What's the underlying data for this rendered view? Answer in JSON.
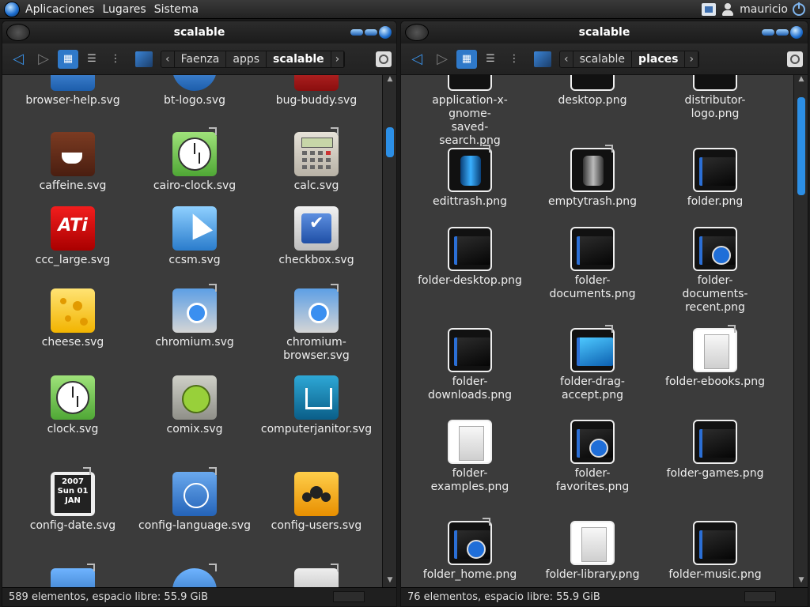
{
  "topbar": {
    "menus": [
      "Aplicaciones",
      "Lugares",
      "Sistema"
    ],
    "user": "mauricio"
  },
  "left": {
    "title": "scalable",
    "breadcrumbs": [
      "Faenza",
      "apps",
      "scalable"
    ],
    "status": "589 elementos, espacio libre: 55.9 GiB",
    "items": [
      {
        "label": "browser-help.svg",
        "icon": "browser-help-icon"
      },
      {
        "label": "bt-logo.svg",
        "icon": "bluetooth-icon"
      },
      {
        "label": "bug-buddy.svg",
        "icon": "bug-icon"
      },
      {
        "label": "caffeine.svg",
        "icon": "coffee-icon"
      },
      {
        "label": "cairo-clock.svg",
        "icon": "clock-icon"
      },
      {
        "label": "calc.svg",
        "icon": "calculator-icon"
      },
      {
        "label": "ccc_large.svg",
        "icon": "ati-icon"
      },
      {
        "label": "ccsm.svg",
        "icon": "cursor-icon"
      },
      {
        "label": "checkbox.svg",
        "icon": "checkbox-icon"
      },
      {
        "label": "cheese.svg",
        "icon": "cheese-icon"
      },
      {
        "label": "chromium.svg",
        "icon": "chromium-icon"
      },
      {
        "label": "chromium-browser.svg",
        "icon": "chromium-icon"
      },
      {
        "label": "clock.svg",
        "icon": "clock-icon"
      },
      {
        "label": "comix.svg",
        "icon": "comix-icon"
      },
      {
        "label": "computerjanitor.svg",
        "icon": "janitor-icon"
      },
      {
        "label": "config-date.svg",
        "icon": "calendar-icon"
      },
      {
        "label": "config-language.svg",
        "icon": "globe-icon"
      },
      {
        "label": "config-users.svg",
        "icon": "users-icon"
      }
    ],
    "calendar": {
      "year": "2007",
      "day": "Sun",
      "date": "01",
      "month": "JAN"
    },
    "ati_text": "ATi"
  },
  "right": {
    "title": "scalable",
    "breadcrumbs": [
      "scalable",
      "places"
    ],
    "status": "76 elementos, espacio libre: 55.9 GiB",
    "items": [
      {
        "label": "application-x-gnome-saved-search.png",
        "icon": "saved-search-icon"
      },
      {
        "label": "desktop.png",
        "icon": "desktop-icon"
      },
      {
        "label": "distributor-logo.png",
        "icon": "distributor-logo-icon"
      },
      {
        "label": "edittrash.png",
        "icon": "trash-full-icon"
      },
      {
        "label": "emptytrash.png",
        "icon": "trash-empty-icon"
      },
      {
        "label": "folder.png",
        "icon": "folder-icon"
      },
      {
        "label": "folder-desktop.png",
        "icon": "folder-desktop-icon"
      },
      {
        "label": "folder-documents.png",
        "icon": "folder-documents-icon"
      },
      {
        "label": "folder-documents-recent.png",
        "icon": "folder-recent-icon"
      },
      {
        "label": "folder-downloads.png",
        "icon": "folder-downloads-icon"
      },
      {
        "label": "folder-drag-accept.png",
        "icon": "folder-drag-icon"
      },
      {
        "label": "folder-ebooks.png",
        "icon": "folder-ebooks-icon"
      },
      {
        "label": "folder-examples.png",
        "icon": "folder-examples-icon"
      },
      {
        "label": "folder-favorites.png",
        "icon": "folder-favorites-icon"
      },
      {
        "label": "folder-games.png",
        "icon": "folder-games-icon"
      },
      {
        "label": "folder_home.png",
        "icon": "folder-home-icon"
      },
      {
        "label": "folder-library.png",
        "icon": "folder-library-icon"
      },
      {
        "label": "folder-music.png",
        "icon": "folder-music-icon"
      }
    ]
  }
}
